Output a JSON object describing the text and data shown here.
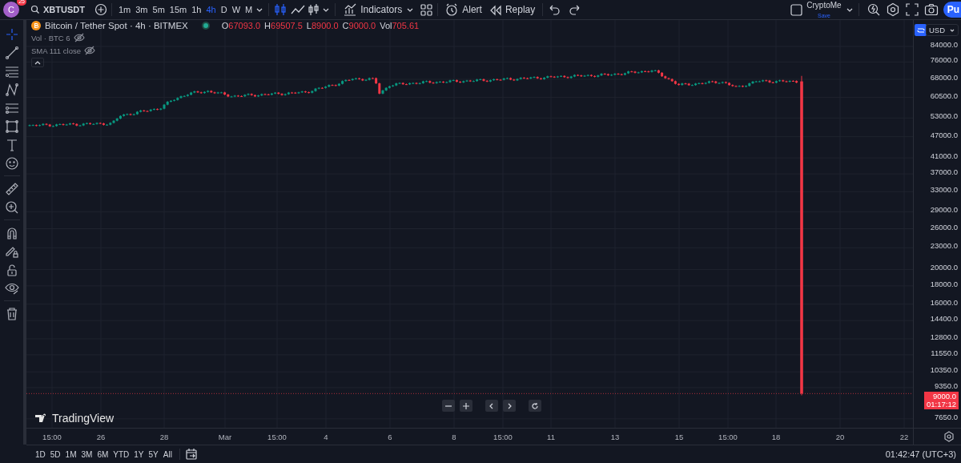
{
  "user": {
    "initial": "C",
    "notifications": "25"
  },
  "symbol": "XBTUSDT",
  "intervals": [
    {
      "label": "1m",
      "selected": false
    },
    {
      "label": "3m",
      "selected": false
    },
    {
      "label": "5m",
      "selected": false
    },
    {
      "label": "15m",
      "selected": false
    },
    {
      "label": "1h",
      "selected": false
    },
    {
      "label": "4h",
      "selected": true
    },
    {
      "label": "D",
      "selected": false
    },
    {
      "label": "W",
      "selected": false
    },
    {
      "label": "M",
      "selected": false
    }
  ],
  "toolbar": {
    "indicators": "Indicators",
    "alert": "Alert",
    "replay": "Replay"
  },
  "layout": {
    "name": "CryptoMe",
    "status": "Save"
  },
  "publish": "Pu",
  "tools": [
    {
      "selected": true
    },
    {
      "selected": false
    },
    {
      "selected": false
    },
    {
      "selected": false
    },
    {
      "selected": false
    },
    {
      "selected": false
    },
    {
      "selected": false
    },
    {
      "selected": false
    },
    {
      "selected": false
    },
    {
      "selected": false
    },
    {
      "selected": false
    },
    {
      "selected": false
    },
    {
      "selected": false
    },
    {
      "selected": false
    },
    {
      "selected": false
    }
  ],
  "legend": {
    "title": "Bitcoin / Tether Spot · 4h · BITMEX",
    "ohlc": [
      {
        "key": "O",
        "value": "67093.0"
      },
      {
        "key": "H",
        "value": "69507.5"
      },
      {
        "key": "L",
        "value": "8900.0"
      },
      {
        "key": "C",
        "value": "9000.0"
      },
      {
        "key": "Vol",
        "value": "705.61"
      }
    ],
    "indicators": [
      "Vol · BTC 6",
      "SMA 111 close"
    ]
  },
  "currency": "USD",
  "price_axis": [
    "84000.0",
    "76000.0",
    "68000.0",
    "60500.0",
    "53000.0",
    "47000.0",
    "41000.0",
    "37000.0",
    "33000.0",
    "29000.0",
    "26000.0",
    "23000.0",
    "20000.0",
    "18000.0",
    "16000.0",
    "14400.0",
    "12800.0",
    "11550.0",
    "10350.0",
    "9350.0",
    "7650.0"
  ],
  "last_price": {
    "price": "9000.0",
    "countdown": "01:17:12"
  },
  "time_axis": [
    "15:00",
    "26",
    "28",
    "Mar",
    "15:00",
    "4",
    "6",
    "8",
    "15:00",
    "11",
    "13",
    "15",
    "15:00",
    "18",
    "20",
    "22"
  ],
  "logo": "TradingView",
  "ranges": [
    "1D",
    "5D",
    "1M",
    "3M",
    "6M",
    "YTD",
    "1Y",
    "5Y",
    "All"
  ],
  "clock": "01:42:47 (UTC+3)"
}
